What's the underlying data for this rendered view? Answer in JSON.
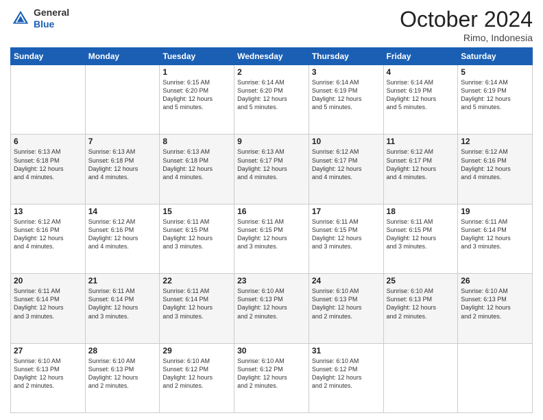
{
  "header": {
    "logo": {
      "line1": "General",
      "line2": "Blue"
    },
    "title": "October 2024",
    "subtitle": "Rimo, Indonesia"
  },
  "days_of_week": [
    "Sunday",
    "Monday",
    "Tuesday",
    "Wednesday",
    "Thursday",
    "Friday",
    "Saturday"
  ],
  "weeks": [
    [
      {
        "day": "",
        "info": ""
      },
      {
        "day": "",
        "info": ""
      },
      {
        "day": "1",
        "info": "Sunrise: 6:15 AM\nSunset: 6:20 PM\nDaylight: 12 hours\nand 5 minutes."
      },
      {
        "day": "2",
        "info": "Sunrise: 6:14 AM\nSunset: 6:20 PM\nDaylight: 12 hours\nand 5 minutes."
      },
      {
        "day": "3",
        "info": "Sunrise: 6:14 AM\nSunset: 6:19 PM\nDaylight: 12 hours\nand 5 minutes."
      },
      {
        "day": "4",
        "info": "Sunrise: 6:14 AM\nSunset: 6:19 PM\nDaylight: 12 hours\nand 5 minutes."
      },
      {
        "day": "5",
        "info": "Sunrise: 6:14 AM\nSunset: 6:19 PM\nDaylight: 12 hours\nand 5 minutes."
      }
    ],
    [
      {
        "day": "6",
        "info": "Sunrise: 6:13 AM\nSunset: 6:18 PM\nDaylight: 12 hours\nand 4 minutes."
      },
      {
        "day": "7",
        "info": "Sunrise: 6:13 AM\nSunset: 6:18 PM\nDaylight: 12 hours\nand 4 minutes."
      },
      {
        "day": "8",
        "info": "Sunrise: 6:13 AM\nSunset: 6:18 PM\nDaylight: 12 hours\nand 4 minutes."
      },
      {
        "day": "9",
        "info": "Sunrise: 6:13 AM\nSunset: 6:17 PM\nDaylight: 12 hours\nand 4 minutes."
      },
      {
        "day": "10",
        "info": "Sunrise: 6:12 AM\nSunset: 6:17 PM\nDaylight: 12 hours\nand 4 minutes."
      },
      {
        "day": "11",
        "info": "Sunrise: 6:12 AM\nSunset: 6:17 PM\nDaylight: 12 hours\nand 4 minutes."
      },
      {
        "day": "12",
        "info": "Sunrise: 6:12 AM\nSunset: 6:16 PM\nDaylight: 12 hours\nand 4 minutes."
      }
    ],
    [
      {
        "day": "13",
        "info": "Sunrise: 6:12 AM\nSunset: 6:16 PM\nDaylight: 12 hours\nand 4 minutes."
      },
      {
        "day": "14",
        "info": "Sunrise: 6:12 AM\nSunset: 6:16 PM\nDaylight: 12 hours\nand 4 minutes."
      },
      {
        "day": "15",
        "info": "Sunrise: 6:11 AM\nSunset: 6:15 PM\nDaylight: 12 hours\nand 3 minutes."
      },
      {
        "day": "16",
        "info": "Sunrise: 6:11 AM\nSunset: 6:15 PM\nDaylight: 12 hours\nand 3 minutes."
      },
      {
        "day": "17",
        "info": "Sunrise: 6:11 AM\nSunset: 6:15 PM\nDaylight: 12 hours\nand 3 minutes."
      },
      {
        "day": "18",
        "info": "Sunrise: 6:11 AM\nSunset: 6:15 PM\nDaylight: 12 hours\nand 3 minutes."
      },
      {
        "day": "19",
        "info": "Sunrise: 6:11 AM\nSunset: 6:14 PM\nDaylight: 12 hours\nand 3 minutes."
      }
    ],
    [
      {
        "day": "20",
        "info": "Sunrise: 6:11 AM\nSunset: 6:14 PM\nDaylight: 12 hours\nand 3 minutes."
      },
      {
        "day": "21",
        "info": "Sunrise: 6:11 AM\nSunset: 6:14 PM\nDaylight: 12 hours\nand 3 minutes."
      },
      {
        "day": "22",
        "info": "Sunrise: 6:11 AM\nSunset: 6:14 PM\nDaylight: 12 hours\nand 3 minutes."
      },
      {
        "day": "23",
        "info": "Sunrise: 6:10 AM\nSunset: 6:13 PM\nDaylight: 12 hours\nand 2 minutes."
      },
      {
        "day": "24",
        "info": "Sunrise: 6:10 AM\nSunset: 6:13 PM\nDaylight: 12 hours\nand 2 minutes."
      },
      {
        "day": "25",
        "info": "Sunrise: 6:10 AM\nSunset: 6:13 PM\nDaylight: 12 hours\nand 2 minutes."
      },
      {
        "day": "26",
        "info": "Sunrise: 6:10 AM\nSunset: 6:13 PM\nDaylight: 12 hours\nand 2 minutes."
      }
    ],
    [
      {
        "day": "27",
        "info": "Sunrise: 6:10 AM\nSunset: 6:13 PM\nDaylight: 12 hours\nand 2 minutes."
      },
      {
        "day": "28",
        "info": "Sunrise: 6:10 AM\nSunset: 6:13 PM\nDaylight: 12 hours\nand 2 minutes."
      },
      {
        "day": "29",
        "info": "Sunrise: 6:10 AM\nSunset: 6:12 PM\nDaylight: 12 hours\nand 2 minutes."
      },
      {
        "day": "30",
        "info": "Sunrise: 6:10 AM\nSunset: 6:12 PM\nDaylight: 12 hours\nand 2 minutes."
      },
      {
        "day": "31",
        "info": "Sunrise: 6:10 AM\nSunset: 6:12 PM\nDaylight: 12 hours\nand 2 minutes."
      },
      {
        "day": "",
        "info": ""
      },
      {
        "day": "",
        "info": ""
      }
    ]
  ]
}
